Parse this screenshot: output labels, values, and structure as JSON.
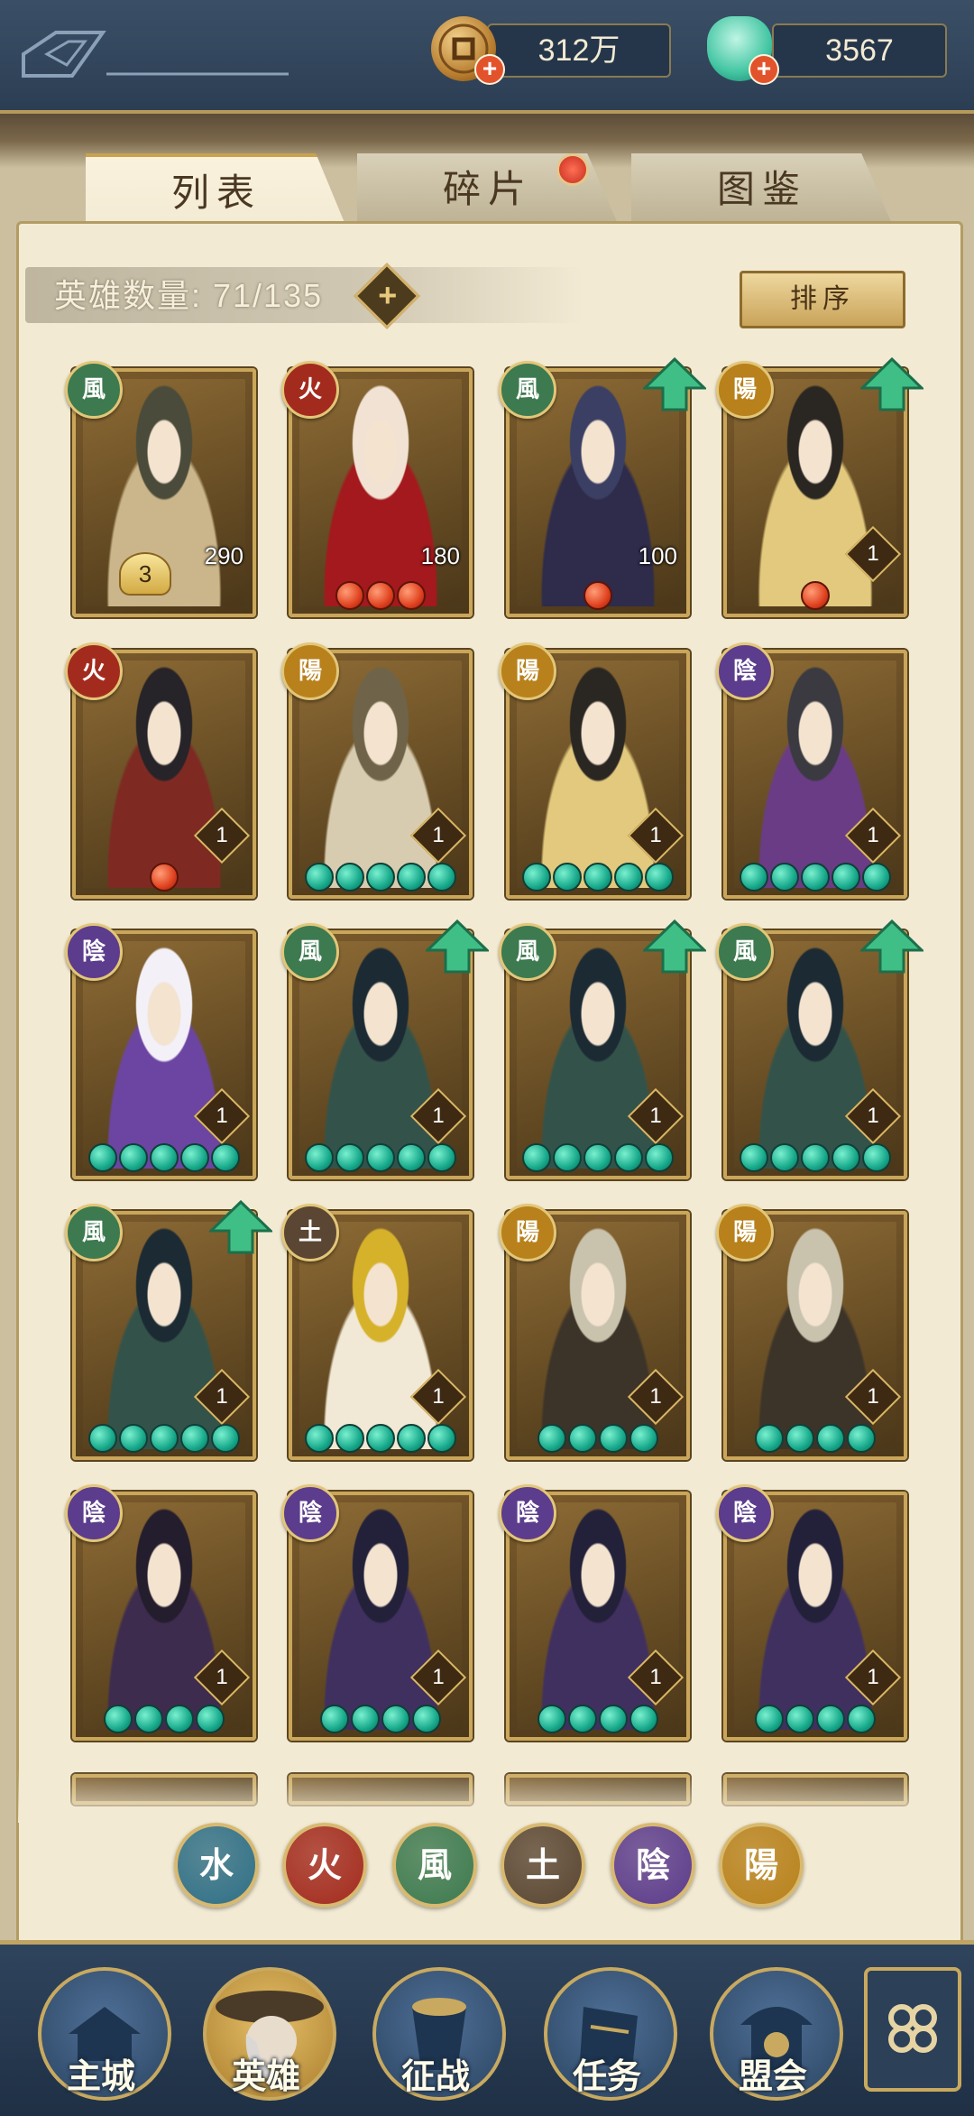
{
  "currency": {
    "coins": {
      "icon": "coin-icon",
      "value": "312万"
    },
    "jade": {
      "icon": "jade-icon",
      "value": "3567"
    }
  },
  "tabs": [
    {
      "label": "列表",
      "active": true
    },
    {
      "label": "碎片",
      "active": false,
      "notification": true
    },
    {
      "label": "图鉴",
      "active": false
    }
  ],
  "hero_count": {
    "label": "英雄数量: 71/135"
  },
  "sort_button": {
    "label": "排序"
  },
  "heroes": [
    {
      "element": "風",
      "level": "3",
      "power": "290",
      "stars": 0,
      "red_stars": 0,
      "upgrade": false,
      "special": "star-badge"
    },
    {
      "element": "火",
      "level": "",
      "power": "180",
      "stars": 0,
      "red_stars": 3,
      "upgrade": false
    },
    {
      "element": "風",
      "level": "",
      "power": "100",
      "stars": 0,
      "red_stars": 1,
      "upgrade": true
    },
    {
      "element": "陽",
      "level": "1",
      "power": "",
      "stars": 0,
      "red_stars": 1,
      "upgrade": true
    },
    {
      "element": "火",
      "level": "1",
      "power": "",
      "stars": 0,
      "red_stars": 1,
      "upgrade": false
    },
    {
      "element": "陽",
      "level": "1",
      "power": "",
      "stars": 5,
      "red_stars": 0,
      "upgrade": false
    },
    {
      "element": "陽",
      "level": "1",
      "power": "",
      "stars": 5,
      "red_stars": 0,
      "upgrade": false
    },
    {
      "element": "陰",
      "level": "1",
      "power": "",
      "stars": 5,
      "red_stars": 0,
      "upgrade": false
    },
    {
      "element": "陰",
      "level": "1",
      "power": "",
      "stars": 5,
      "red_stars": 0,
      "upgrade": false
    },
    {
      "element": "風",
      "level": "1",
      "power": "",
      "stars": 5,
      "red_stars": 0,
      "upgrade": true
    },
    {
      "element": "風",
      "level": "1",
      "power": "",
      "stars": 5,
      "red_stars": 0,
      "upgrade": true
    },
    {
      "element": "風",
      "level": "1",
      "power": "",
      "stars": 5,
      "red_stars": 0,
      "upgrade": true
    },
    {
      "element": "風",
      "level": "1",
      "power": "",
      "stars": 5,
      "red_stars": 0,
      "upgrade": true
    },
    {
      "element": "土",
      "level": "1",
      "power": "",
      "stars": 5,
      "red_stars": 0,
      "upgrade": false
    },
    {
      "element": "陽",
      "level": "1",
      "power": "",
      "stars": 4,
      "red_stars": 0,
      "upgrade": false
    },
    {
      "element": "陽",
      "level": "1",
      "power": "",
      "stars": 4,
      "red_stars": 0,
      "upgrade": false
    },
    {
      "element": "陰",
      "level": "1",
      "power": "",
      "stars": 4,
      "red_stars": 0,
      "upgrade": false
    },
    {
      "element": "陰",
      "level": "1",
      "power": "",
      "stars": 4,
      "red_stars": 0,
      "upgrade": false
    },
    {
      "element": "陰",
      "level": "1",
      "power": "",
      "stars": 4,
      "red_stars": 0,
      "upgrade": false
    },
    {
      "element": "陰",
      "level": "1",
      "power": "",
      "stars": 4,
      "red_stars": 0,
      "upgrade": false
    }
  ],
  "element_colors": {
    "風": "#3d7a4f",
    "火": "#a32b1e",
    "陽": "#b8811b",
    "陰": "#5c3c8c",
    "土": "#5a4632",
    "水": "#2f6f86"
  },
  "filters": [
    {
      "label": "水",
      "color": "#2f6f86"
    },
    {
      "label": "火",
      "color": "#a32b1e"
    },
    {
      "label": "風",
      "color": "#3d7a4f"
    },
    {
      "label": "土",
      "color": "#5a4632"
    },
    {
      "label": "陰",
      "color": "#5c3c8c"
    },
    {
      "label": "陽",
      "color": "#b8811b"
    }
  ],
  "nav": [
    {
      "label": "主城",
      "icon": "city-icon",
      "active": false
    },
    {
      "label": "英雄",
      "icon": "hero-icon",
      "active": true
    },
    {
      "label": "征战",
      "icon": "battle-icon",
      "active": false
    },
    {
      "label": "任务",
      "icon": "quest-icon",
      "active": false
    },
    {
      "label": "盟会",
      "icon": "guild-icon",
      "active": false
    }
  ],
  "more_button": {
    "icon": "menu-icon"
  }
}
